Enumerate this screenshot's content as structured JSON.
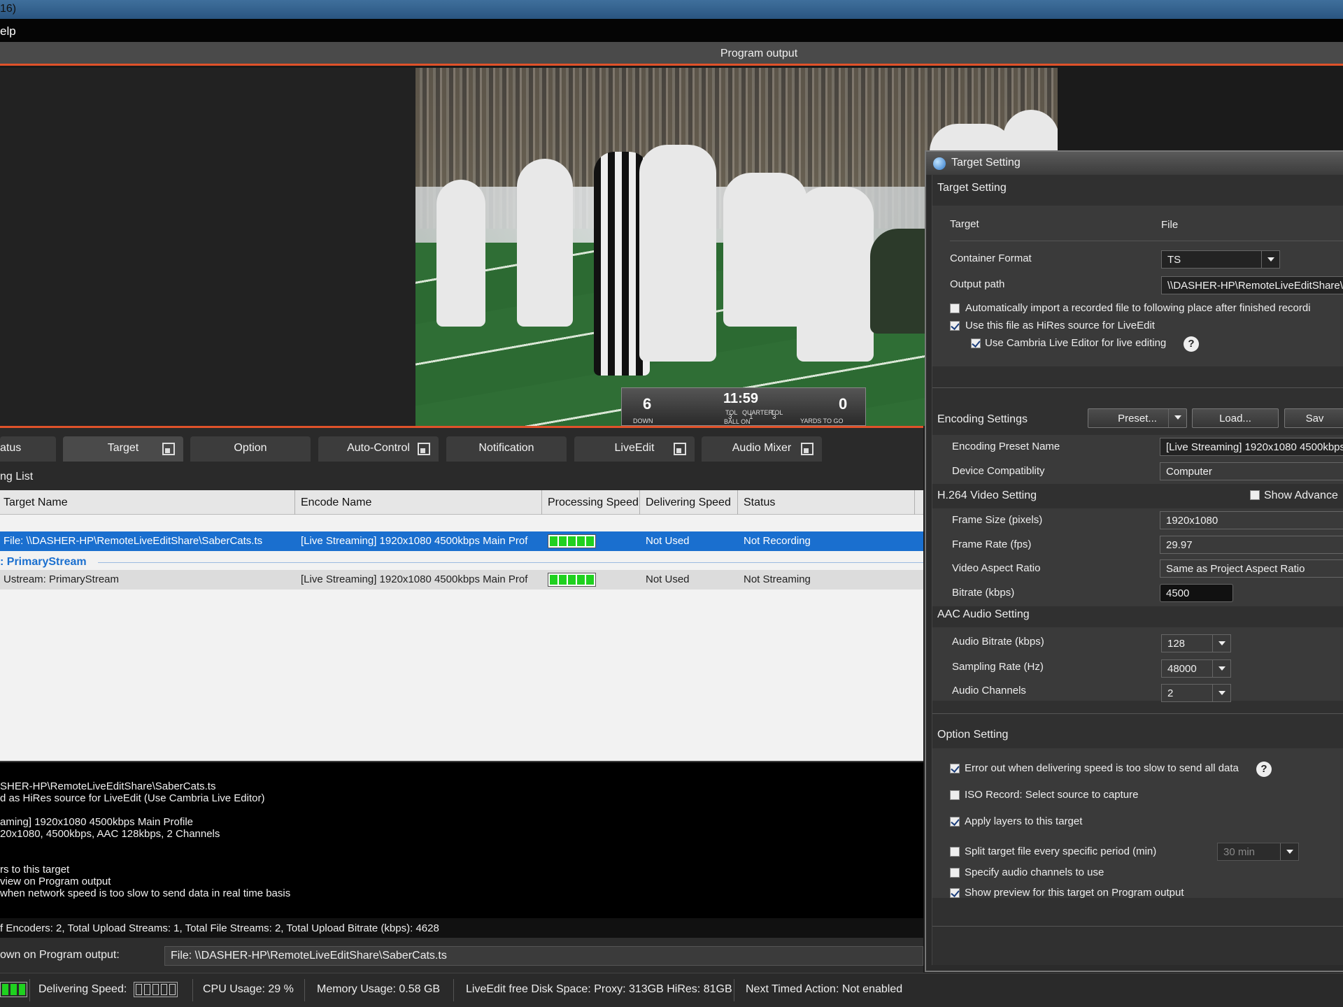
{
  "window": {
    "title_fragment": "16)",
    "menu_fragment": "elp"
  },
  "program_output": {
    "title": "Program output"
  },
  "scoreboard": {
    "left": "6",
    "clock": "11:59",
    "right": "0",
    "down_label": "DOWN",
    "qtr_label": "QUARTER",
    "ball_on": "BALL ON",
    "yards": "YARDS TO GO",
    "tol_l": "TOL",
    "tol_r": "TOL",
    "v1": "3",
    "v2": "1",
    "v3": "3"
  },
  "tabs": [
    {
      "label": "atus"
    },
    {
      "label": "Target"
    },
    {
      "label": "Option"
    },
    {
      "label": "Auto-Control"
    },
    {
      "label": "Notification"
    },
    {
      "label": "LiveEdit"
    },
    {
      "label": "Audio Mixer"
    }
  ],
  "list": {
    "title": "ng List",
    "columns": [
      "Target Name",
      "Encode Name",
      "Processing Speed",
      "Delivering Speed",
      "Status"
    ],
    "rows": [
      {
        "target": "File: \\\\DASHER-HP\\RemoteLiveEditShare\\SaberCats.ts",
        "encode": "[Live Streaming] 1920x1080 4500kbps Main Prof",
        "processing": 5,
        "delivering": "Not Used",
        "status": "Not Recording"
      },
      {
        "target": "Ustream: PrimaryStream",
        "encode": "[Live Streaming] 1920x1080 4500kbps Main Prof",
        "processing": 5,
        "delivering": "Not Used",
        "status": "Not Streaming"
      }
    ],
    "group": ": PrimaryStream"
  },
  "info_lines": [
    "SHER-HP\\RemoteLiveEditShare\\SaberCats.ts",
    "d as HiRes source for LiveEdit (Use Cambria Live Editor)",
    "",
    "aming] 1920x1080 4500kbps Main Profile",
    "20x1080, 4500kbps, AAC 128kbps, 2 Channels",
    "",
    "",
    "rs to this target",
    "view on Program output",
    "when network speed is too slow to send data in real time basis"
  ],
  "summary": "f Encoders: 2, Total Upload Streams: 1, Total File Streams: 2, Total Upload Bitrate (kbps): 4628",
  "shown": {
    "label": "own on Program output:",
    "value": "File: \\\\DASHER-HP\\RemoteLiveEditShare\\SaberCats.ts"
  },
  "statusbar": {
    "delivering_label": "Delivering Speed:",
    "cpu": "CPU Usage:  29 %",
    "memory": "Memory Usage: 0.58 GB",
    "disk": "LiveEdit free Disk Space:   Proxy: 313GB  HiRes: 81GB",
    "timed": "Next Timed Action:   Not enabled"
  },
  "dialog": {
    "title": "Target Setting",
    "target_section": "Target Setting",
    "target_label": "Target",
    "target_value": "File",
    "container_label": "Container Format",
    "container_value": "TS",
    "output_label": "Output path",
    "output_value": "\\\\DASHER-HP\\RemoteLiveEditShare\\Sa",
    "auto_import": "Automatically import a recorded file to following place after finished recordi",
    "hires": "Use this file as HiRes source for LiveEdit",
    "cambria": "Use Cambria Live Editor for live editing",
    "encoding_section": "Encoding Settings",
    "preset_btn": "Preset...",
    "load_btn": "Load...",
    "save_btn": "Sav",
    "preset_name_label": "Encoding Preset Name",
    "preset_name_value": "[Live Streaming] 1920x1080 4500kbps",
    "device_label": "Device Compatiblity",
    "device_value": "Computer",
    "h264_section": "H.264 Video Setting",
    "show_adv": "Show Advance",
    "frame_size_label": "Frame Size (pixels)",
    "frame_size_value": "1920x1080",
    "frame_rate_label": "Frame Rate (fps)",
    "frame_rate_value": "29.97",
    "aspect_label": "Video Aspect Ratio",
    "aspect_value": "Same as Project Aspect Ratio",
    "bitrate_label": "Bitrate (kbps)",
    "bitrate_value": "4500",
    "aac_section": "AAC Audio Setting",
    "abitrate_label": "Audio Bitrate (kbps)",
    "abitrate_value": "128",
    "srate_label": "Sampling Rate (Hz)",
    "srate_value": "48000",
    "channels_label": "Audio Channels",
    "channels_value": "2",
    "option_section": "Option Setting",
    "opt_error": "Error out when delivering speed is too slow to send all data",
    "opt_iso": "ISO Record: Select source to capture",
    "opt_layers": "Apply layers to this target",
    "opt_split": "Split target file every specific period (min)",
    "opt_split_value": "30 min",
    "opt_audio": "Specify audio channels to use",
    "opt_preview": "Show preview for this target on Program output"
  }
}
